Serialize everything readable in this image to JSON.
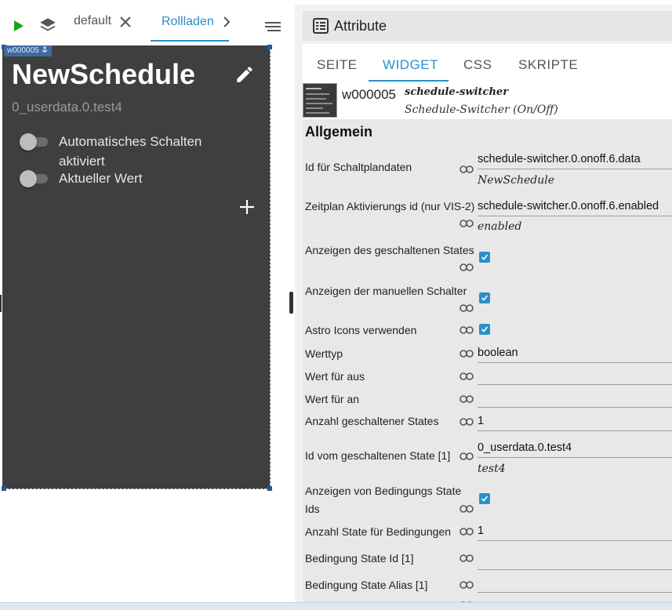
{
  "toolbar": {
    "tabs": [
      {
        "label": "default"
      },
      {
        "label": "Rollladen"
      }
    ],
    "icons": {
      "play": "play-icon",
      "layers": "layers-icon",
      "close": "close-icon",
      "chevron": "chevron-right-icon",
      "menu": "menu-icon"
    },
    "play_color": "#1aa31a",
    "accent": "#2c8fc7"
  },
  "widget_canvas": {
    "tag": "w000005",
    "title": "NewSchedule",
    "subtitle": "0_userdata.0.test4",
    "switches": [
      {
        "label": "Automatisches Schalten aktiviert",
        "on": false
      },
      {
        "label": "Aktueller Wert",
        "on": false
      }
    ],
    "background": "#3f3f3f"
  },
  "panel": {
    "title": "Attribute",
    "tabs": [
      {
        "label": "SEITE"
      },
      {
        "label": "WIDGET",
        "active": true
      },
      {
        "label": "CSS"
      },
      {
        "label": "SKRIPTE"
      }
    ],
    "widget": {
      "id": "w000005",
      "type": "schedule-switcher",
      "description": "Schedule-Switcher (On/Off)"
    },
    "group": "Allgemein",
    "attributes": [
      {
        "label": "Id für Schaltplandaten",
        "value": "schedule-switcher.0.onoff.6.data",
        "hint": "NewSchedule"
      },
      {
        "label": "Zeitplan Aktivierungs id (nur VIS-2)",
        "value": "schedule-switcher.0.onoff.6.enabled",
        "hint": "enabled"
      },
      {
        "label": "Anzeigen des geschaltenen States",
        "checked": true
      },
      {
        "label": "Anzeigen der manuellen Schalter",
        "checked": true
      },
      {
        "label": "Astro Icons verwenden",
        "checked": true
      },
      {
        "label": "Werttyp",
        "value": "boolean"
      },
      {
        "label": "Wert für aus",
        "value": ""
      },
      {
        "label": "Wert für an",
        "value": ""
      },
      {
        "label": "Anzahl geschaltener States",
        "value": "1"
      },
      {
        "label": "Id vom geschaltenen State [1]",
        "value": "0_userdata.0.test4",
        "hint": "test4"
      },
      {
        "label": "Anzeigen von Bedingungs State Ids",
        "checked": true
      },
      {
        "label": "Anzahl State für Bedingungen",
        "value": "1"
      },
      {
        "label": "Bedingung State Id [1]",
        "value": ""
      },
      {
        "label": "Bedingung State Alias [1]",
        "value": ""
      }
    ]
  }
}
